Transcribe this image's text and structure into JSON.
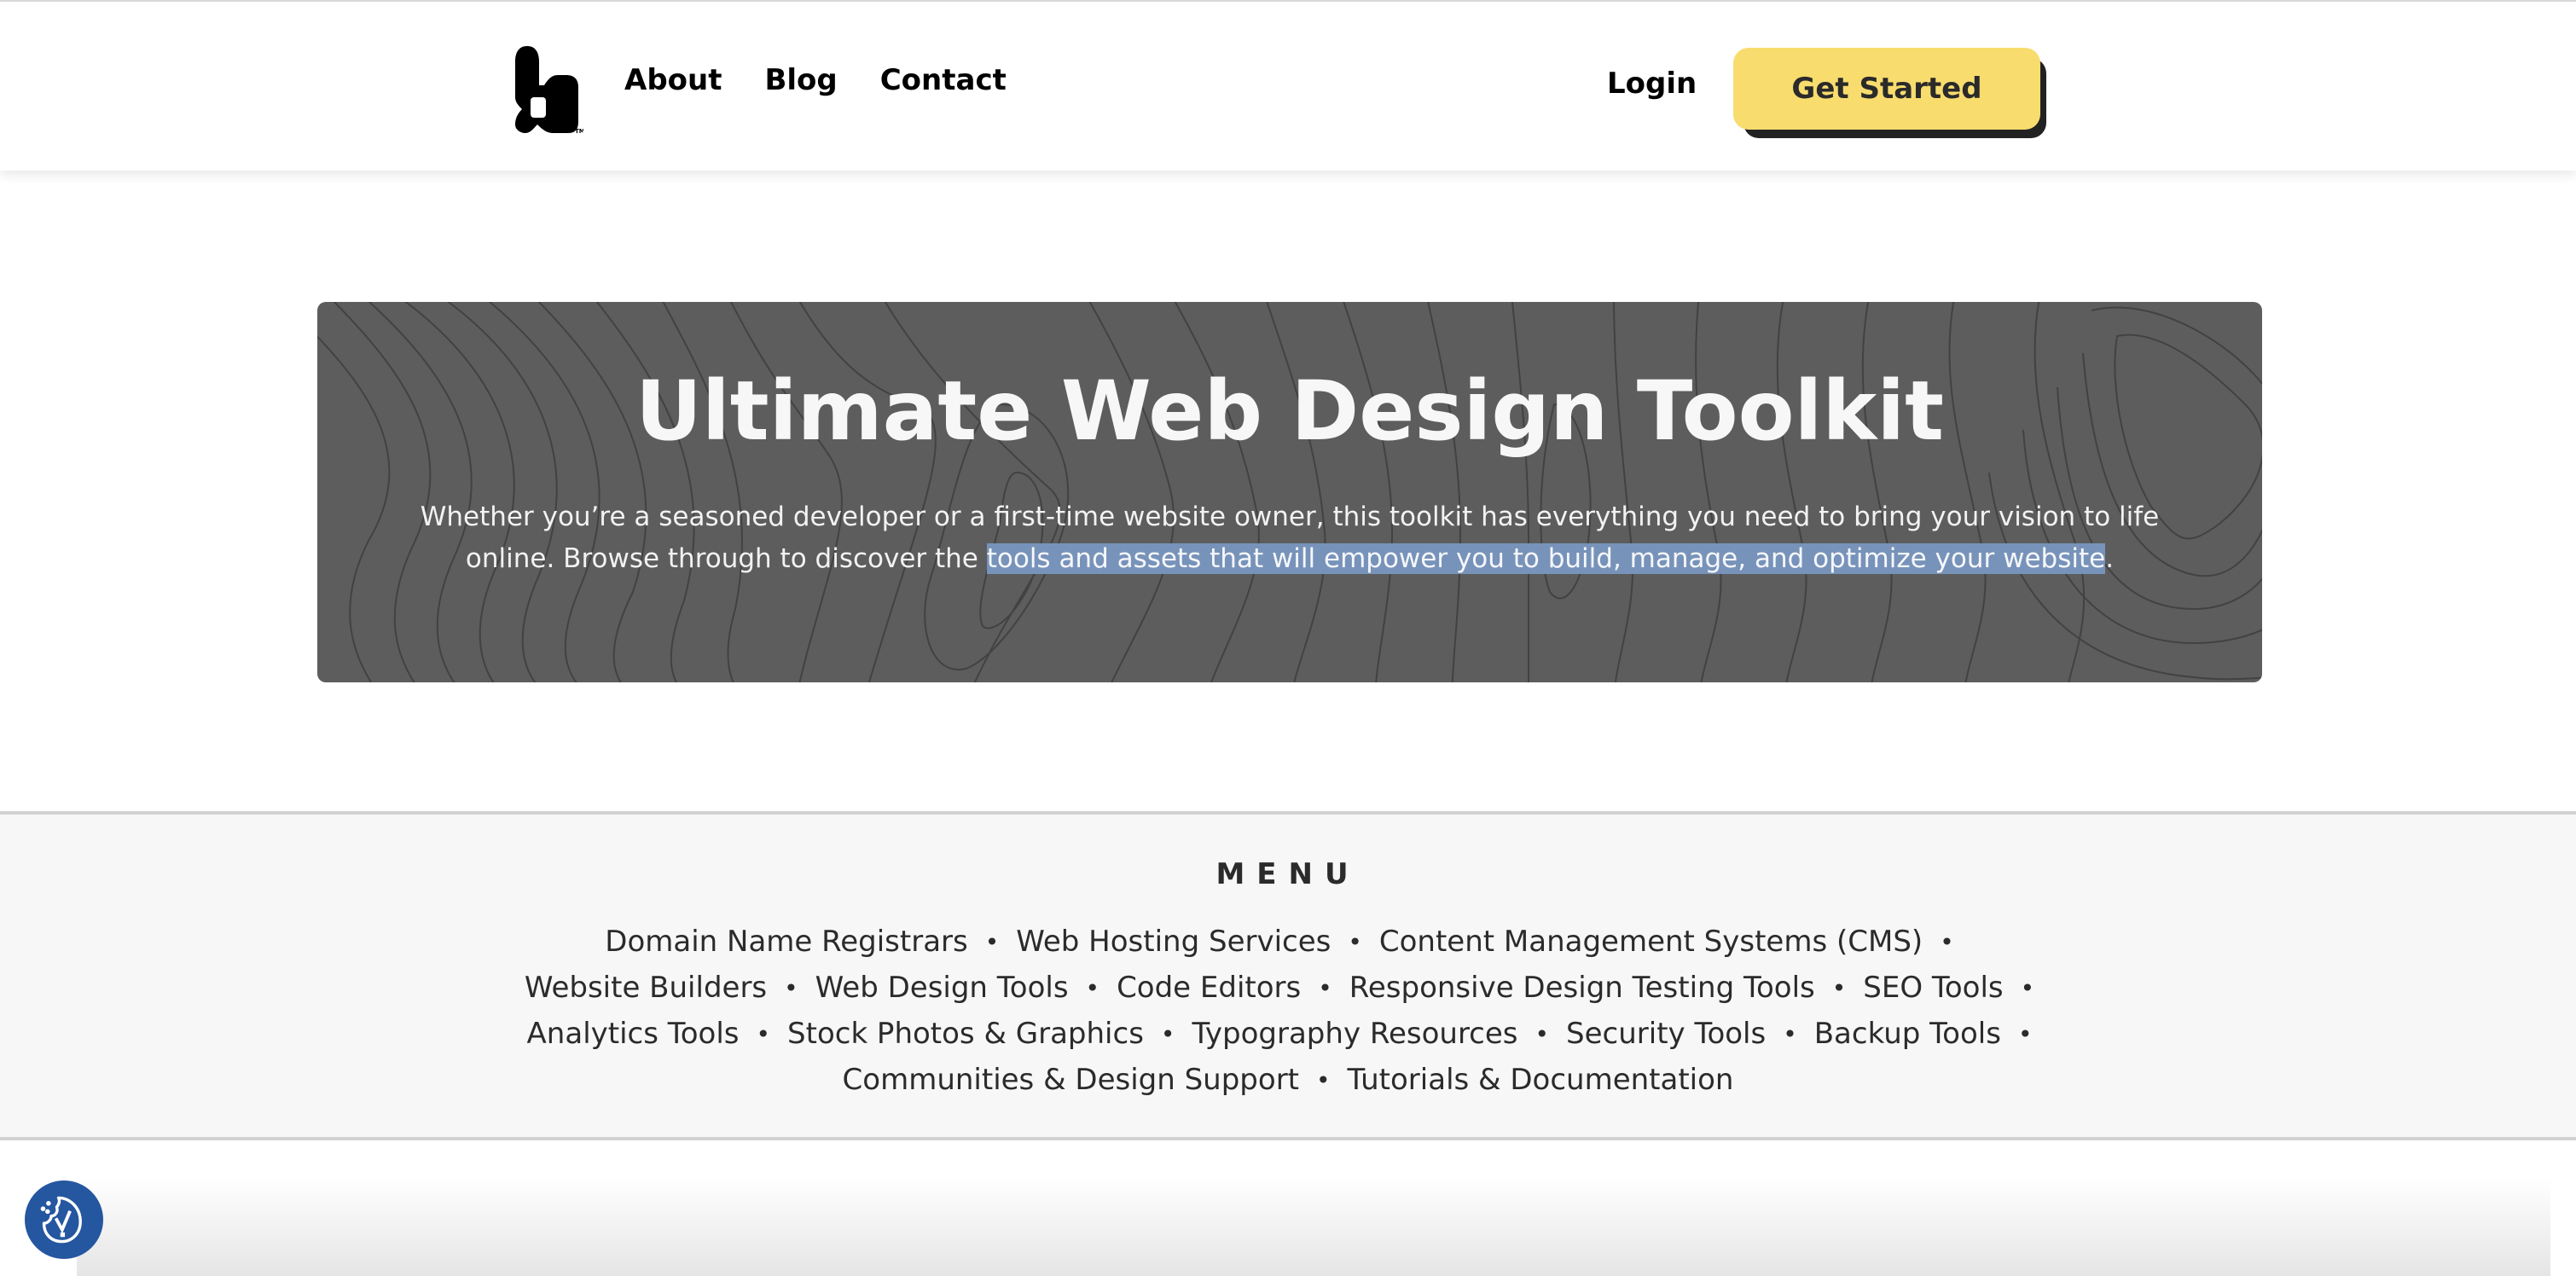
{
  "header": {
    "logo_alt": "b logo",
    "logo_mark": "TM",
    "nav": [
      {
        "label": "About"
      },
      {
        "label": "Blog"
      },
      {
        "label": "Contact"
      }
    ],
    "login_label": "Login",
    "cta_label": "Get Started",
    "cta_color": "#f8dc6e"
  },
  "hero": {
    "title": "Ultimate Web Design Toolkit",
    "desc_line1": "Whether you’re a seasoned developer or a first-time website owner, this toolkit has everything you need to bring your vision to life",
    "desc_line2_before": "online. Browse through to discover the ",
    "desc_line2_selected": "tools and assets that will empower you to build, manage, and optimize your website",
    "desc_line2_after": ".",
    "background_color": "#5d5d5d",
    "selection_color": "#7893ba"
  },
  "menu": {
    "heading": "MENU",
    "separator": "•",
    "lines": [
      [
        "Domain Name Registrars",
        "Web Hosting Services",
        "Content Management Systems (CMS)"
      ],
      [
        "Website Builders",
        "Web Design Tools",
        "Code Editors",
        "Responsive Design Testing Tools",
        "SEO Tools"
      ],
      [
        "Analytics Tools",
        "Stock Photos & Graphics",
        "Typography Resources",
        "Security Tools",
        "Backup Tools"
      ],
      [
        "Communities & Design Support",
        "Tutorials & Documentation"
      ]
    ]
  },
  "cookie": {
    "icon": "cookie-consent-icon",
    "color": "#2556a0"
  }
}
